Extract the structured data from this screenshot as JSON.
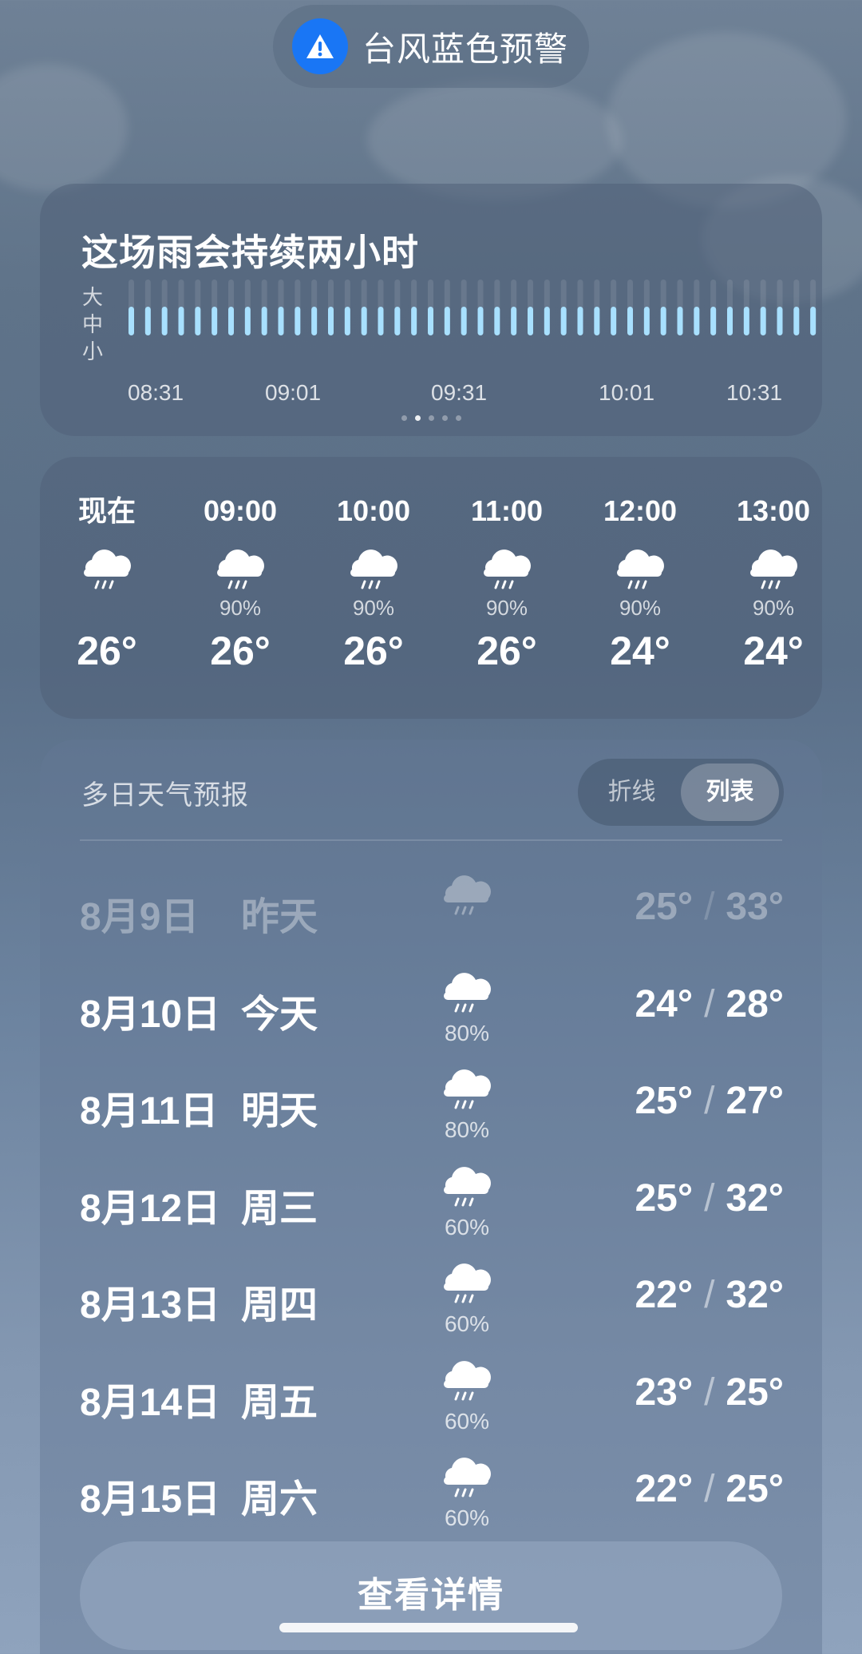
{
  "warning": {
    "text": "台风蓝色预警",
    "icon": "warning-triangle-icon",
    "icon_bg": "#1976f5"
  },
  "rain": {
    "title": "这场雨会持续两小时",
    "scale": [
      "大",
      "中",
      "小"
    ],
    "bar_count": 42,
    "intensity": "small",
    "bar_color": "#a8e0ff",
    "times": [
      "08:31",
      "09:01",
      "09:31",
      "10:01",
      "10:31"
    ],
    "pager_count": 5,
    "pager_active": 1
  },
  "hourly": [
    {
      "time": "现在",
      "prob": "",
      "temp": "26°",
      "icon": "rain-cloud-icon"
    },
    {
      "time": "09:00",
      "prob": "90%",
      "temp": "26°",
      "icon": "rain-cloud-icon"
    },
    {
      "time": "10:00",
      "prob": "90%",
      "temp": "26°",
      "icon": "rain-cloud-icon"
    },
    {
      "time": "11:00",
      "prob": "90%",
      "temp": "26°",
      "icon": "rain-cloud-icon"
    },
    {
      "time": "12:00",
      "prob": "90%",
      "temp": "24°",
      "icon": "rain-cloud-icon"
    },
    {
      "time": "13:00",
      "prob": "90%",
      "temp": "24°",
      "icon": "rain-cloud-icon"
    }
  ],
  "daily": {
    "title": "多日天气预报",
    "toggle": {
      "line": "折线",
      "list": "列表",
      "active": "list"
    },
    "days": [
      {
        "date": "8月9日",
        "name": "昨天",
        "prob": "",
        "low": "25°",
        "high": "33°",
        "past": true,
        "icon": "rain-cloud-icon"
      },
      {
        "date": "8月10日",
        "name": "今天",
        "prob": "80%",
        "low": "24°",
        "high": "28°",
        "past": false,
        "icon": "rain-cloud-icon"
      },
      {
        "date": "8月11日",
        "name": "明天",
        "prob": "80%",
        "low": "25°",
        "high": "27°",
        "past": false,
        "icon": "rain-cloud-icon"
      },
      {
        "date": "8月12日",
        "name": "周三",
        "prob": "60%",
        "low": "25°",
        "high": "32°",
        "past": false,
        "icon": "rain-cloud-icon"
      },
      {
        "date": "8月13日",
        "name": "周四",
        "prob": "60%",
        "low": "22°",
        "high": "32°",
        "past": false,
        "icon": "rain-cloud-icon"
      },
      {
        "date": "8月14日",
        "name": "周五",
        "prob": "60%",
        "low": "23°",
        "high": "25°",
        "past": false,
        "icon": "rain-cloud-icon"
      },
      {
        "date": "8月15日",
        "name": "周六",
        "prob": "60%",
        "low": "22°",
        "high": "25°",
        "past": false,
        "icon": "rain-cloud-icon"
      }
    ],
    "separator": "/",
    "details_label": "查看详情"
  }
}
